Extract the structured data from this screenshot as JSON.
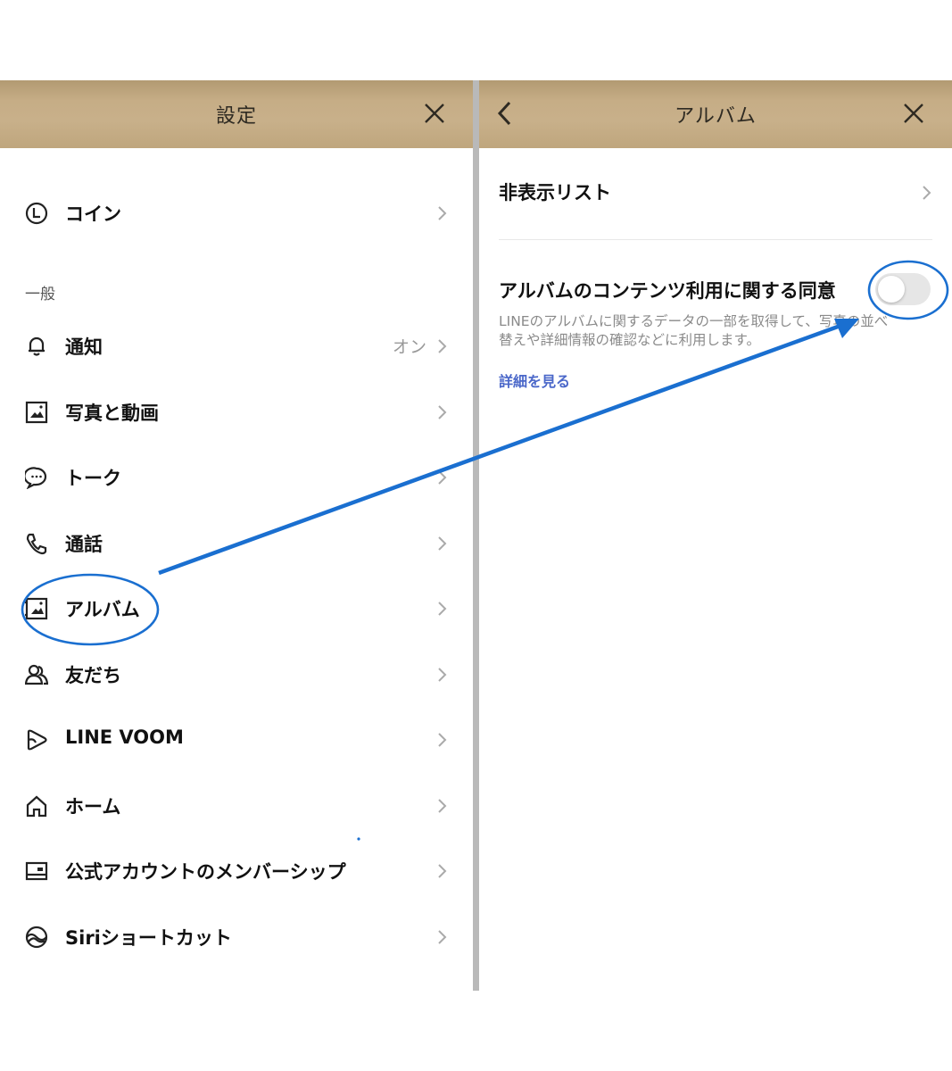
{
  "left": {
    "title": "設定",
    "top_item": {
      "label": "コイン",
      "icon": "coin-icon"
    },
    "section_label": "一般",
    "items": [
      {
        "label": "通知",
        "value": "オン",
        "icon": "bell-icon"
      },
      {
        "label": "写真と動画",
        "icon": "photo-icon"
      },
      {
        "label": "トーク",
        "icon": "chat-bubble-icon"
      },
      {
        "label": "通話",
        "icon": "phone-icon"
      },
      {
        "label": "アルバム",
        "icon": "album-icon"
      },
      {
        "label": "友だち",
        "icon": "friends-icon"
      },
      {
        "label": "LINE VOOM",
        "icon": "voom-icon"
      },
      {
        "label": "ホーム",
        "icon": "home-icon"
      },
      {
        "label": "公式アカウントのメンバーシップ",
        "icon": "membership-icon"
      },
      {
        "label": "Siriショートカット",
        "icon": "siri-icon"
      }
    ]
  },
  "right": {
    "title": "アルバム",
    "hidden_list_label": "非表示リスト",
    "consent_label": "アルバムのコンテンツ利用に関する同意",
    "consent_desc_line1": "LINEのアルバムに関するデータの一部を取得して、写真の並べ",
    "consent_desc_line2": "替えや詳細情報の確認などに利用します。",
    "details_link": "詳細を見る",
    "consent_enabled": false
  },
  "colors": {
    "header": "#c6ad86",
    "annotation": "#1a6fd0",
    "link": "#4a67c9",
    "toggle_off": "#e6e6e6"
  }
}
